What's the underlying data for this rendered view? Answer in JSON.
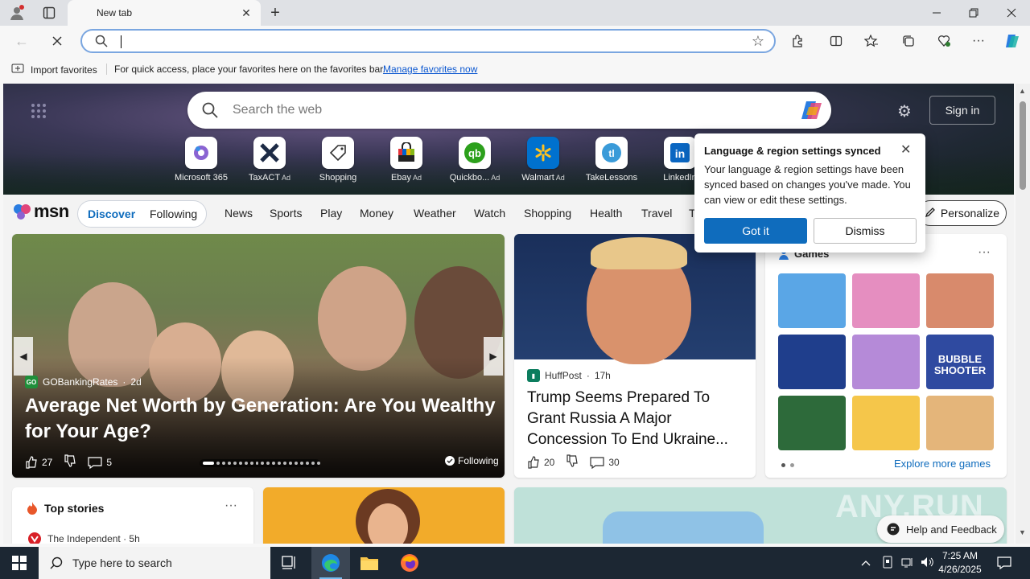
{
  "browser": {
    "tab_title": "New tab",
    "omnibox_value": ""
  },
  "favorites_bar": {
    "import_label": "Import favorites",
    "hint_text": "For quick access, place your favorites here on the favorites bar.",
    "manage_link": "Manage favorites now"
  },
  "hero": {
    "search_placeholder": "Search the web",
    "signin_label": "Sign in",
    "quick_links": [
      {
        "label": "Microsoft 365",
        "ad": ""
      },
      {
        "label": "TaxACT",
        "ad": "Ad"
      },
      {
        "label": "Shopping",
        "ad": ""
      },
      {
        "label": "Ebay",
        "ad": "Ad"
      },
      {
        "label": "Quickbo...",
        "ad": "Ad"
      },
      {
        "label": "Walmart",
        "ad": "Ad"
      },
      {
        "label": "TakeLessons",
        "ad": ""
      },
      {
        "label": "LinkedIn",
        "ad": ""
      }
    ]
  },
  "msn": {
    "logo_text": "msn",
    "discover": "Discover",
    "following": "Following",
    "nav_links": [
      "News",
      "Sports",
      "Play",
      "Money",
      "Weather",
      "Watch",
      "Shopping",
      "Health",
      "Travel",
      "T"
    ],
    "personalize": "Personalize"
  },
  "hero_card": {
    "source": "GOBankingRates",
    "age": "2d",
    "title": "Average Net Worth by Generation: Are You Wealthy for Your Age?",
    "likes": "27",
    "comments": "5",
    "following_label": "Following"
  },
  "news_card": {
    "source": "HuffPost",
    "age": "17h",
    "title": "Trump Seems Prepared To Grant Russia A Major Concession To End Ukraine...",
    "likes": "20",
    "comments": "30"
  },
  "games_card": {
    "title": "Games",
    "explore_label": "Explore more games",
    "tiles": [
      {
        "name": "game-tile-restaurant",
        "color": "#5aa6e6",
        "text": ""
      },
      {
        "name": "game-tile-fashion",
        "color": "#e58ec0",
        "text": ""
      },
      {
        "name": "game-tile-hospital",
        "color": "#d88a6c",
        "text": ""
      },
      {
        "name": "game-tile-blocks",
        "color": "#1f3e8c",
        "text": ""
      },
      {
        "name": "game-tile-makeup",
        "color": "#b58ad8",
        "text": ""
      },
      {
        "name": "game-tile-bubble-shooter",
        "color": "#2f4aa0",
        "text": "BUBBLE SHOOTER"
      },
      {
        "name": "game-tile-mahjong",
        "color": "#2d6a3a",
        "text": ""
      },
      {
        "name": "game-tile-cupcake",
        "color": "#f5c64a",
        "text": ""
      },
      {
        "name": "game-tile-wood-puzzle",
        "color": "#e4b57a",
        "text": ""
      }
    ]
  },
  "top_stories": {
    "title": "Top stories",
    "source": "The Independent · 5h"
  },
  "popup": {
    "title": "Language & region settings synced",
    "body": "Your language & region settings have been synced based on changes you've made. You can view or edit these settings.",
    "primary": "Got it",
    "secondary": "Dismiss"
  },
  "help_feedback": "Help and Feedback",
  "watermark": "ANY.RUN",
  "taskbar": {
    "search_placeholder": "Type here to search",
    "time": "7:25 AM",
    "date": "4/26/2025"
  },
  "colors": {
    "accent": "#0f6cbd",
    "taskbar": "#1c2733"
  }
}
